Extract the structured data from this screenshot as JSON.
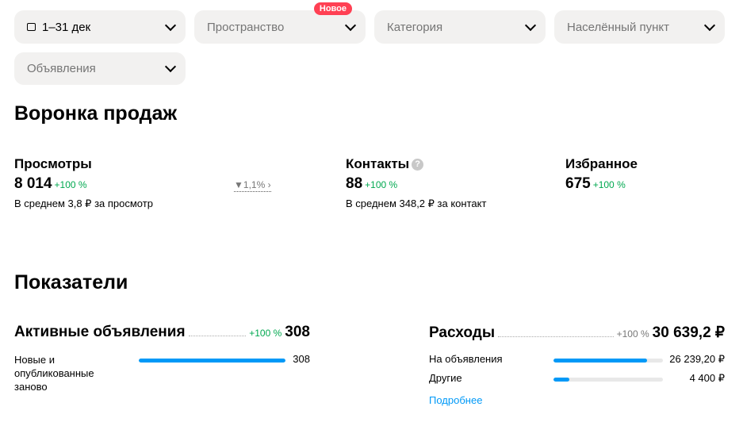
{
  "filters": {
    "date": "1–31 дек",
    "space": "Пространство",
    "space_badge": "Новое",
    "category": "Категория",
    "locality": "Населённый пункт",
    "ads": "Объявления"
  },
  "funnel": {
    "title": "Воронка продаж",
    "views": {
      "title": "Просмотры",
      "value": "8 014",
      "change": "+100 %",
      "sub": "В среднем 3,8 ₽ за просмотр",
      "conversion": "1,1%"
    },
    "contacts": {
      "title": "Контакты",
      "help": "?",
      "value": "88",
      "change": "+100 %",
      "sub": "В среднем 348,2 ₽ за контакт"
    },
    "favorites": {
      "title": "Избранное",
      "value": "675",
      "change": "+100 %"
    }
  },
  "indicators": {
    "title": "Показатели",
    "active": {
      "title": "Активные объявления",
      "change": "+100 %",
      "value": "308",
      "rows": [
        {
          "label": "Новые и опубликованные заново",
          "value": "308",
          "fraction": 1.0
        }
      ]
    },
    "expenses": {
      "title": "Расходы",
      "change": "+100 %",
      "value": "30 639,2 ₽",
      "rows": [
        {
          "label": "На объявления",
          "value": "26 239,20 ₽",
          "fraction": 0.856
        },
        {
          "label": "Другие",
          "value": "4 400 ₽",
          "fraction": 0.144
        }
      ],
      "more": "Подробнее"
    }
  },
  "colors": {
    "accent": "#0099f7",
    "positive": "#00a84f",
    "badge": "#ff4053"
  }
}
